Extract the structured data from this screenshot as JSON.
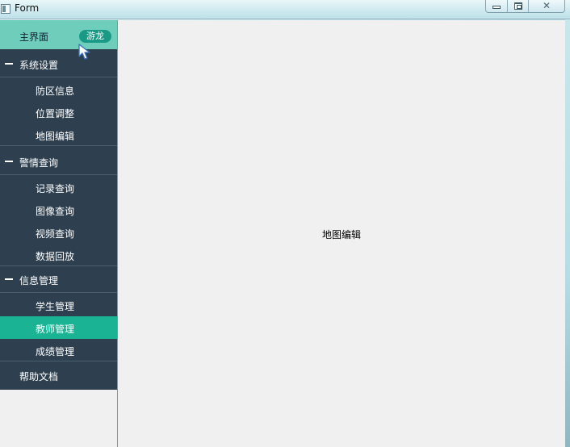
{
  "window": {
    "title": "Form",
    "controls": {
      "minimize": "minimize",
      "maximize": "maximize",
      "close": "close"
    }
  },
  "sidebar": {
    "home": {
      "label": "主界面",
      "badge": "游龙"
    },
    "groups": [
      {
        "label": "系统设置",
        "items": [
          {
            "label": "防区信息"
          },
          {
            "label": "位置调整"
          },
          {
            "label": "地图编辑"
          }
        ]
      },
      {
        "label": "警情查询",
        "items": [
          {
            "label": "记录查询"
          },
          {
            "label": "图像查询"
          },
          {
            "label": "视频查询"
          },
          {
            "label": "数据回放"
          }
        ]
      },
      {
        "label": "信息管理",
        "items": [
          {
            "label": "学生管理"
          },
          {
            "label": "教师管理",
            "active": true
          },
          {
            "label": "成绩管理"
          }
        ]
      }
    ],
    "help": {
      "label": "帮助文档"
    }
  },
  "content": {
    "label": "地图编辑"
  },
  "colors": {
    "nav_bg": "#2e4050",
    "home_bg": "#6fcdbb",
    "badge_bg": "#1a9a86",
    "active_bg": "#1ab394",
    "content_bg": "#f0f0f0"
  }
}
